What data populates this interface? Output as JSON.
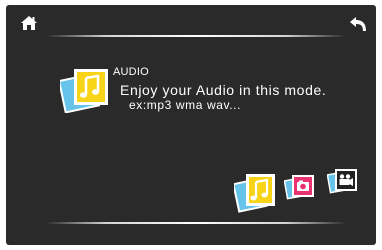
{
  "nav": {
    "home_icon": "home-icon",
    "back_icon": "back-arrow-icon"
  },
  "mode": {
    "title": "AUDIO",
    "description_line1": "Enjoy your Audio in this mode.",
    "description_line2": "ex:mp3  wma  wav..."
  },
  "mode_selector": [
    {
      "icon": "audio-note-icon",
      "accent": "#f7d417",
      "selected": true
    },
    {
      "icon": "photo-icon",
      "accent": "#e8336f",
      "selected": false
    },
    {
      "icon": "video-camera-icon",
      "accent": "#222222",
      "selected": false
    }
  ],
  "colors": {
    "background": "#2a2a2a",
    "text": "#ffffff",
    "audio_yellow": "#f7d417",
    "photo_pink": "#e8336f",
    "frame_blue": "#66c3ea"
  }
}
